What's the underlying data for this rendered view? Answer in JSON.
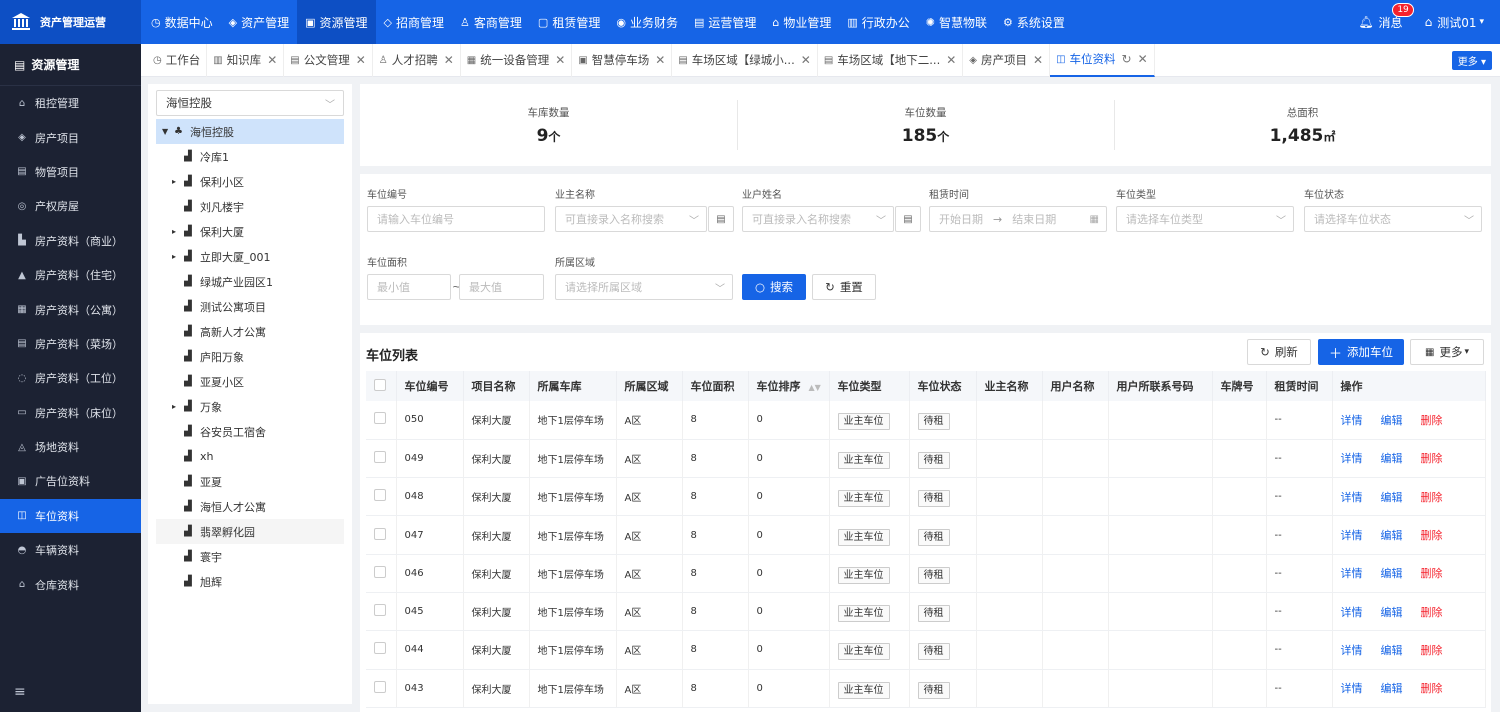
{
  "app": {
    "title": "资产管理运营"
  },
  "topnav": [
    {
      "label": "数据中心",
      "icon": "◷"
    },
    {
      "label": "资产管理",
      "icon": "◈"
    },
    {
      "label": "资源管理",
      "icon": "▣",
      "active": true
    },
    {
      "label": "招商管理",
      "icon": "◇"
    },
    {
      "label": "客商管理",
      "icon": "♙"
    },
    {
      "label": "租赁管理",
      "icon": "▢"
    },
    {
      "label": "业务财务",
      "icon": "◉"
    },
    {
      "label": "运营管理",
      "icon": "▤"
    },
    {
      "label": "物业管理",
      "icon": "⌂"
    },
    {
      "label": "行政办公",
      "icon": "▥"
    },
    {
      "label": "智慧物联",
      "icon": "✺"
    },
    {
      "label": "系统设置",
      "icon": "⚙"
    }
  ],
  "header": {
    "messages": "消息",
    "message_count": "19",
    "user": "测试01"
  },
  "sidebar": {
    "title": "资源管理",
    "items": [
      {
        "label": "租控管理",
        "icon": "⌂"
      },
      {
        "label": "房产项目",
        "icon": "◈"
      },
      {
        "label": "物管项目",
        "icon": "▤"
      },
      {
        "label": "产权房屋",
        "icon": "◎"
      },
      {
        "label": "房产资料（商业）",
        "icon": "▙"
      },
      {
        "label": "房产资料（住宅）",
        "icon": "▲"
      },
      {
        "label": "房产资料（公寓）",
        "icon": "▦"
      },
      {
        "label": "房产资料（菜场）",
        "icon": "▤"
      },
      {
        "label": "房产资料（工位）",
        "icon": "◌"
      },
      {
        "label": "房产资料（床位）",
        "icon": "▭"
      },
      {
        "label": "场地资料",
        "icon": "◬"
      },
      {
        "label": "广告位资料",
        "icon": "▣"
      },
      {
        "label": "车位资料",
        "icon": "◫",
        "active": true
      },
      {
        "label": "车辆资料",
        "icon": "◓"
      },
      {
        "label": "仓库资料",
        "icon": "⌂"
      }
    ],
    "collapse_icon": "≡"
  },
  "tabs": [
    {
      "label": "工作台",
      "icon": "◷",
      "closable": false
    },
    {
      "label": "知识库",
      "icon": "▥",
      "closable": true
    },
    {
      "label": "公文管理",
      "icon": "▤",
      "closable": true
    },
    {
      "label": "人才招聘",
      "icon": "♙",
      "closable": true
    },
    {
      "label": "统一设备管理",
      "icon": "▦",
      "closable": true
    },
    {
      "label": "智慧停车场",
      "icon": "▣",
      "closable": true
    },
    {
      "label": "车场区域【绿城小...",
      "icon": "▤",
      "closable": true
    },
    {
      "label": "车场区域【地下二...",
      "icon": "▤",
      "closable": true
    },
    {
      "label": "房产项目",
      "icon": "◈",
      "closable": true
    },
    {
      "label": "车位资料",
      "icon": "◫",
      "closable": true,
      "active": true
    }
  ],
  "tabs_more": "更多 ▾",
  "tree": {
    "selected": "海恒控股",
    "root": "海恒控股",
    "nodes": [
      {
        "label": "冷库1",
        "expandable": false
      },
      {
        "label": "保利小区",
        "expandable": true
      },
      {
        "label": "刘凡楼宇",
        "expandable": false
      },
      {
        "label": "保利大厦",
        "expandable": true
      },
      {
        "label": "立即大厦_001",
        "expandable": true
      },
      {
        "label": "绿城产业园区1",
        "expandable": false
      },
      {
        "label": "测试公寓项目",
        "expandable": false
      },
      {
        "label": "高新人才公寓",
        "expandable": false
      },
      {
        "label": "庐阳万象",
        "expandable": false
      },
      {
        "label": "亚夏小区",
        "expandable": false
      },
      {
        "label": "万象",
        "expandable": true
      },
      {
        "label": "谷安员工宿舍",
        "expandable": false
      },
      {
        "label": "xh",
        "expandable": false
      },
      {
        "label": "亚夏",
        "expandable": false
      },
      {
        "label": "海恒人才公寓",
        "expandable": false
      },
      {
        "label": "翡翠孵化园",
        "expandable": false,
        "hover": true
      },
      {
        "label": "寰宇",
        "expandable": false
      },
      {
        "label": "旭辉",
        "expandable": false
      }
    ]
  },
  "stats": [
    {
      "label": "车库数量",
      "value": "9",
      "unit": "个"
    },
    {
      "label": "车位数量",
      "value": "185",
      "unit": "个"
    },
    {
      "label": "总面积",
      "value": "1,485",
      "unit": "㎡"
    }
  ],
  "filters": {
    "space_no": {
      "label": "车位编号",
      "placeholder": "请输入车位编号"
    },
    "owner": {
      "label": "业主名称",
      "placeholder": "可直接录入名称搜索"
    },
    "tenant": {
      "label": "业户姓名",
      "placeholder": "可直接录入名称搜索"
    },
    "rent_time": {
      "label": "租赁时间",
      "start": "开始日期",
      "sep": "→",
      "end": "结束日期"
    },
    "space_type": {
      "label": "车位类型",
      "placeholder": "请选择车位类型"
    },
    "space_status": {
      "label": "车位状态",
      "placeholder": "请选择车位状态"
    },
    "area": {
      "label": "车位面积",
      "min": "最小值",
      "sep": "~",
      "max": "最大值"
    },
    "region": {
      "label": "所属区域",
      "placeholder": "请选择所属区域"
    },
    "search": "搜索",
    "reset": "重置"
  },
  "table": {
    "title": "车位列表",
    "refresh": "刷新",
    "add": "添加车位",
    "more": "更多",
    "columns": [
      "车位编号",
      "项目名称",
      "所属车库",
      "所属区域",
      "车位面积",
      "车位排序",
      "车位类型",
      "车位状态",
      "业主名称",
      "用户名称",
      "用户所联系号码",
      "车牌号",
      "租赁时间",
      "操作"
    ],
    "rows": [
      {
        "no": "050",
        "project": "保利大厦",
        "garage": "地下1层停车场",
        "region": "A区",
        "area": "8",
        "sort": "0",
        "type": "业主车位",
        "status": "待租",
        "rent": "--"
      },
      {
        "no": "049",
        "project": "保利大厦",
        "garage": "地下1层停车场",
        "region": "A区",
        "area": "8",
        "sort": "0",
        "type": "业主车位",
        "status": "待租",
        "rent": "--"
      },
      {
        "no": "048",
        "project": "保利大厦",
        "garage": "地下1层停车场",
        "region": "A区",
        "area": "8",
        "sort": "0",
        "type": "业主车位",
        "status": "待租",
        "rent": "--"
      },
      {
        "no": "047",
        "project": "保利大厦",
        "garage": "地下1层停车场",
        "region": "A区",
        "area": "8",
        "sort": "0",
        "type": "业主车位",
        "status": "待租",
        "rent": "--"
      },
      {
        "no": "046",
        "project": "保利大厦",
        "garage": "地下1层停车场",
        "region": "A区",
        "area": "8",
        "sort": "0",
        "type": "业主车位",
        "status": "待租",
        "rent": "--"
      },
      {
        "no": "045",
        "project": "保利大厦",
        "garage": "地下1层停车场",
        "region": "A区",
        "area": "8",
        "sort": "0",
        "type": "业主车位",
        "status": "待租",
        "rent": "--"
      },
      {
        "no": "044",
        "project": "保利大厦",
        "garage": "地下1层停车场",
        "region": "A区",
        "area": "8",
        "sort": "0",
        "type": "业主车位",
        "status": "待租",
        "rent": "--"
      },
      {
        "no": "043",
        "project": "保利大厦",
        "garage": "地下1层停车场",
        "region": "A区",
        "area": "8",
        "sort": "0",
        "type": "业主车位",
        "status": "待租",
        "rent": "--"
      }
    ],
    "ops": {
      "detail": "详情",
      "edit": "编辑",
      "delete": "删除"
    }
  },
  "colors": {
    "primary": "#1664e6",
    "sidebar": "#1c2233",
    "danger": "#f5222d"
  }
}
